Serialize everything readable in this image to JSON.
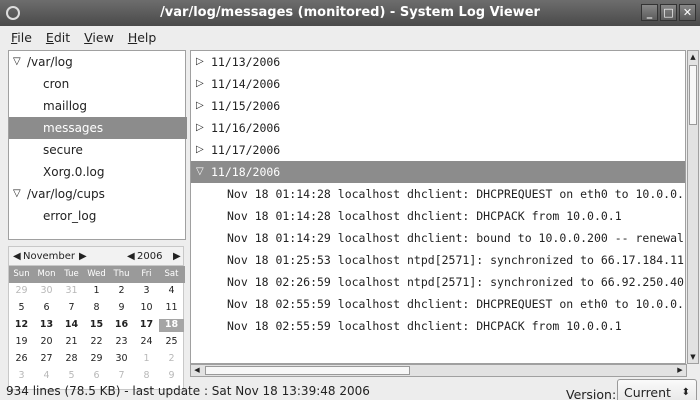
{
  "window": {
    "title": "/var/log/messages (monitored) - System Log Viewer"
  },
  "menu": [
    "File",
    "Edit",
    "View",
    "Help"
  ],
  "tree": [
    {
      "label": "/var/log",
      "kind": "group",
      "expander": "▽"
    },
    {
      "label": "cron",
      "kind": "child"
    },
    {
      "label": "maillog",
      "kind": "child"
    },
    {
      "label": "messages",
      "kind": "child",
      "selected": true
    },
    {
      "label": "secure",
      "kind": "child"
    },
    {
      "label": "Xorg.0.log",
      "kind": "child"
    },
    {
      "label": "/var/log/cups",
      "kind": "group",
      "expander": "▽"
    },
    {
      "label": "error_log",
      "kind": "child"
    }
  ],
  "calendar": {
    "month": "November",
    "year": "2006",
    "days": [
      "Sun",
      "Mon",
      "Tue",
      "Wed",
      "Thu",
      "Fri",
      "Sat"
    ],
    "rows": [
      [
        [
          "29",
          "o"
        ],
        [
          "30",
          "o"
        ],
        [
          "31",
          "o"
        ],
        [
          "1",
          ""
        ],
        [
          "2",
          ""
        ],
        [
          "3",
          ""
        ],
        [
          "4",
          ""
        ]
      ],
      [
        [
          "5",
          ""
        ],
        [
          "6",
          ""
        ],
        [
          "7",
          ""
        ],
        [
          "8",
          ""
        ],
        [
          "9",
          ""
        ],
        [
          "10",
          ""
        ],
        [
          "11",
          ""
        ]
      ],
      [
        [
          "12",
          "b"
        ],
        [
          "13",
          "b"
        ],
        [
          "14",
          "b"
        ],
        [
          "15",
          "b"
        ],
        [
          "16",
          "b"
        ],
        [
          "17",
          "b"
        ],
        [
          "18",
          "t"
        ]
      ],
      [
        [
          "19",
          ""
        ],
        [
          "20",
          ""
        ],
        [
          "21",
          ""
        ],
        [
          "22",
          ""
        ],
        [
          "23",
          ""
        ],
        [
          "24",
          ""
        ],
        [
          "25",
          ""
        ]
      ],
      [
        [
          "26",
          ""
        ],
        [
          "27",
          ""
        ],
        [
          "28",
          ""
        ],
        [
          "29",
          ""
        ],
        [
          "30",
          ""
        ],
        [
          "1",
          "o"
        ],
        [
          "2",
          "o"
        ]
      ],
      [
        [
          "3",
          "o"
        ],
        [
          "4",
          "o"
        ],
        [
          "5",
          "o"
        ],
        [
          "6",
          "o"
        ],
        [
          "7",
          "o"
        ],
        [
          "8",
          "o"
        ],
        [
          "9",
          "o"
        ]
      ]
    ]
  },
  "log": [
    {
      "kind": "date",
      "text": "11/13/2006"
    },
    {
      "kind": "date",
      "text": "11/14/2006"
    },
    {
      "kind": "date",
      "text": "11/15/2006"
    },
    {
      "kind": "date",
      "text": "11/16/2006"
    },
    {
      "kind": "date",
      "text": "11/17/2006"
    },
    {
      "kind": "date",
      "text": "11/18/2006",
      "expanded": true,
      "selected": true
    },
    {
      "kind": "line",
      "text": "Nov 18 01:14:28 localhost dhclient: DHCPREQUEST on eth0 to 10.0.0."
    },
    {
      "kind": "line",
      "text": "Nov 18 01:14:28 localhost dhclient: DHCPACK from 10.0.0.1"
    },
    {
      "kind": "line",
      "text": "Nov 18 01:14:29 localhost dhclient: bound to 10.0.0.200 -- renewal"
    },
    {
      "kind": "line",
      "text": "Nov 18 01:25:53 localhost ntpd[2571]: synchronized to 66.17.184.11"
    },
    {
      "kind": "line",
      "text": "Nov 18 02:26:59 localhost ntpd[2571]: synchronized to 66.92.250.40"
    },
    {
      "kind": "line",
      "text": "Nov 18 02:55:59 localhost dhclient: DHCPREQUEST on eth0 to 10.0.0."
    },
    {
      "kind": "line",
      "text": "Nov 18 02:55:59 localhost dhclient: DHCPACK from 10.0.0.1"
    }
  ],
  "version": {
    "label": "Version:",
    "value": "Current"
  },
  "status": "934 lines (78.5 KB) - last update : Sat Nov 18 13:39:48 2006",
  "colors": {
    "selection": "#8c8c8c",
    "titlebar": "#4a4a4a"
  },
  "icons": {
    "app": "log-viewer-icon",
    "minimize": "minimize-icon",
    "maximize": "maximize-icon",
    "close": "close-icon"
  }
}
